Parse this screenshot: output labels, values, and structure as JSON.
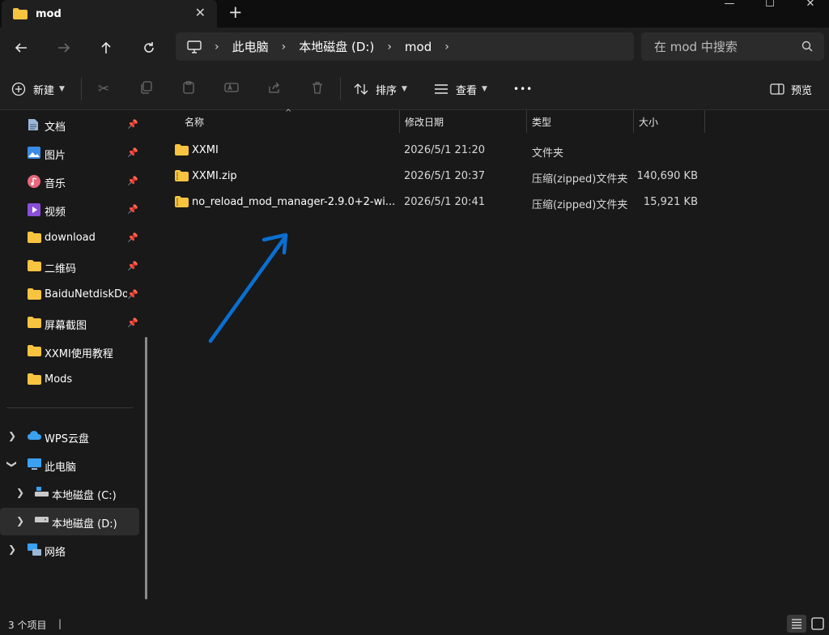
{
  "tab": {
    "title": "mod",
    "close": "✕"
  },
  "newtab": "+",
  "window": {
    "minimize": "—",
    "maximize": "☐",
    "close": "✕"
  },
  "address": {
    "crumbs": [
      "此电脑",
      "本地磁盘 (D:)",
      "mod"
    ],
    "separator": "›"
  },
  "search": {
    "placeholder": "在 mod 中搜索"
  },
  "toolbar": {
    "new_label": "新建",
    "sort_label": "排序",
    "view_label": "查看",
    "more": "•••",
    "preview_label": "预览"
  },
  "sidebar": {
    "quick_access": [
      {
        "label": "文档",
        "icon": "documents-icon",
        "pinned": true
      },
      {
        "label": "图片",
        "icon": "pictures-icon",
        "pinned": true
      },
      {
        "label": "音乐",
        "icon": "music-icon",
        "pinned": true
      },
      {
        "label": "视频",
        "icon": "videos-icon",
        "pinned": true
      },
      {
        "label": "download",
        "icon": "folder-icon",
        "pinned": true
      },
      {
        "label": "二维码",
        "icon": "folder-icon",
        "pinned": true
      },
      {
        "label": "BaiduNetdiskDownload",
        "icon": "folder-icon",
        "pinned": true
      },
      {
        "label": "屏幕截图",
        "icon": "folder-icon",
        "pinned": true
      },
      {
        "label": "XXMI使用教程",
        "icon": "folder-icon",
        "pinned": false
      },
      {
        "label": "Mods",
        "icon": "folder-icon",
        "pinned": false
      }
    ],
    "tree": [
      {
        "label": "WPS云盘",
        "icon": "cloud-icon"
      },
      {
        "label": "此电脑",
        "icon": "monitor-icon"
      },
      {
        "label": "本地磁盘 (C:)",
        "icon": "drive-c-icon"
      },
      {
        "label": "本地磁盘 (D:)",
        "icon": "drive-icon"
      },
      {
        "label": "网络",
        "icon": "network-icon"
      }
    ],
    "colors": {
      "folder": "#f8c440",
      "selected": "#2d2d2d"
    }
  },
  "columns": {
    "name": "名称",
    "modified": "修改日期",
    "type": "类型",
    "size": "大小"
  },
  "files": [
    {
      "name": "XXMI",
      "modified": "2026/5/1 21:20",
      "type": "文件夹",
      "size": "",
      "icon": "folder-icon"
    },
    {
      "name": "XXMI.zip",
      "modified": "2026/5/1 20:37",
      "type": "压缩(zipped)文件夹",
      "size": "140,690 KB",
      "icon": "zip-folder-icon"
    },
    {
      "name": "no_reload_mod_manager-2.9.0+2-wi...",
      "modified": "2026/5/1 20:41",
      "type": "压缩(zipped)文件夹",
      "size": "15,921 KB",
      "icon": "zip-folder-icon"
    }
  ],
  "status": {
    "count": "3 个项目"
  },
  "annotation": {
    "color": "#0a6fd1"
  }
}
